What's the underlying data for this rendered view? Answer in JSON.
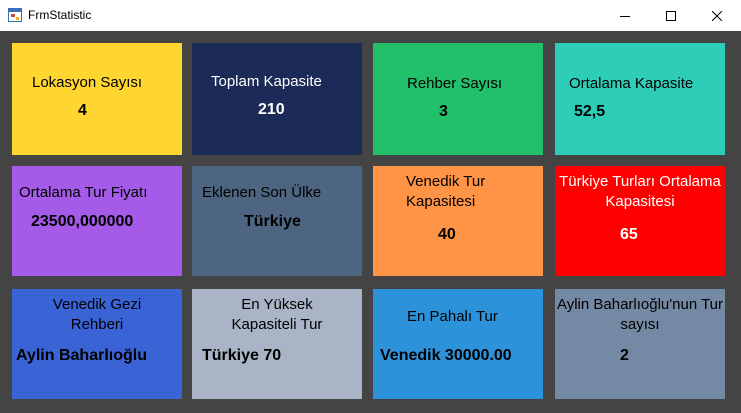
{
  "window": {
    "title": "FrmStatistic",
    "icon": "winforms-app-icon",
    "controls": [
      "minimize-icon",
      "maximize-icon",
      "close-icon"
    ]
  },
  "colors": {
    "client_background": "#444444",
    "yellow": "#FFD52F",
    "navy": "#1B2A56",
    "green": "#22C06B",
    "teal": "#2ECDB7",
    "purple": "#A35BE8",
    "slate": "#4D6580",
    "orange": "#FF9446",
    "red": "#FF0000",
    "royal_blue": "#3A63D6",
    "light_steel": "#A9B5C6",
    "sky_blue": "#2C93DB",
    "gray_blue": "#7489A3"
  },
  "tiles": [
    {
      "label": "Lokasyon Sayısı",
      "value": "4"
    },
    {
      "label": "Toplam Kapasite",
      "value": "210"
    },
    {
      "label": "Rehber Sayısı",
      "value": "3"
    },
    {
      "label": "Ortalama Kapasite",
      "value": "52,5"
    },
    {
      "label": "Ortalama Tur Fiyatı",
      "value": "23500,000000"
    },
    {
      "label": "Eklenen Son Ülke",
      "value": "Türkiye"
    },
    {
      "label": "Venedik Tur Kapasitesi",
      "value": "40"
    },
    {
      "label": "Türkiye Turları Ortalama Kapasitesi",
      "value": "65"
    },
    {
      "label": "Venedik Gezi Rehberi",
      "value": "Aylin Baharlıoğlu"
    },
    {
      "label": "En Yüksek Kapasiteli Tur",
      "value": "Türkiye 70"
    },
    {
      "label": "En Pahalı Tur",
      "value": "Venedik 30000.00"
    },
    {
      "label": "Aylin Baharlıoğlu'nun Tur sayısı",
      "value": "2"
    }
  ]
}
